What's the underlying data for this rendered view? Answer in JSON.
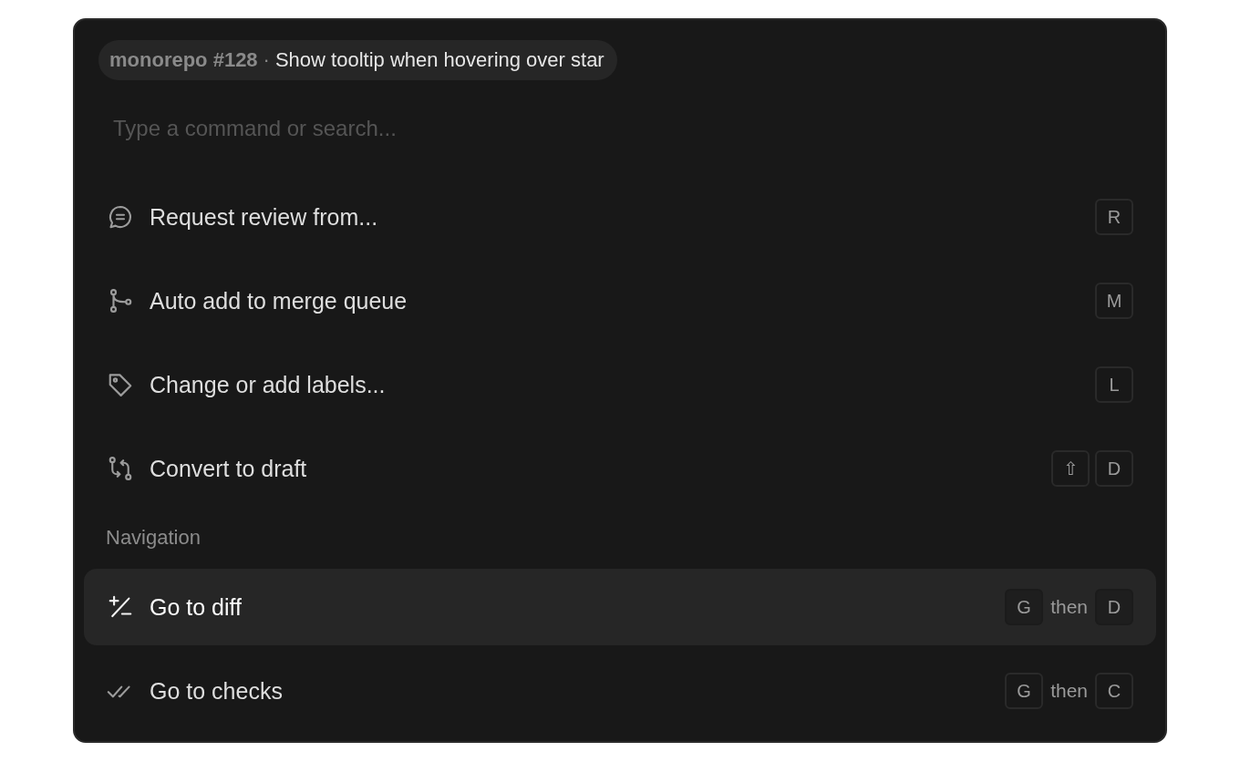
{
  "breadcrumb": {
    "repository": "monorepo #128",
    "separator": "·",
    "title": "Show tooltip when hovering over star"
  },
  "search": {
    "placeholder": "Type a command or search..."
  },
  "groups": [
    {
      "commands": [
        {
          "kind": "review",
          "label": "Request review from...",
          "selected": false,
          "shortcut": [
            {
              "kind": "key",
              "text": "R"
            }
          ]
        },
        {
          "kind": "merge",
          "label": "Auto add to merge queue",
          "selected": false,
          "shortcut": [
            {
              "kind": "key",
              "text": "M"
            }
          ]
        },
        {
          "kind": "labels",
          "label": "Change or add labels...",
          "selected": false,
          "shortcut": [
            {
              "kind": "key",
              "text": "L"
            }
          ]
        },
        {
          "kind": "draft",
          "label": "Convert to draft",
          "selected": false,
          "shortcut": [
            {
              "kind": "key",
              "text": "⇧"
            },
            {
              "kind": "key",
              "text": "D"
            }
          ]
        }
      ]
    },
    {
      "heading": "Navigation",
      "commands": [
        {
          "kind": "diff",
          "label": "Go to diff",
          "selected": true,
          "shortcut": [
            {
              "kind": "key",
              "text": "G"
            },
            {
              "kind": "word",
              "text": "then"
            },
            {
              "kind": "key",
              "text": "D"
            }
          ]
        },
        {
          "kind": "checks",
          "label": "Go to checks",
          "selected": false,
          "shortcut": [
            {
              "kind": "key",
              "text": "G"
            },
            {
              "kind": "word",
              "text": "then"
            },
            {
              "kind": "key",
              "text": "C"
            }
          ]
        }
      ]
    }
  ]
}
